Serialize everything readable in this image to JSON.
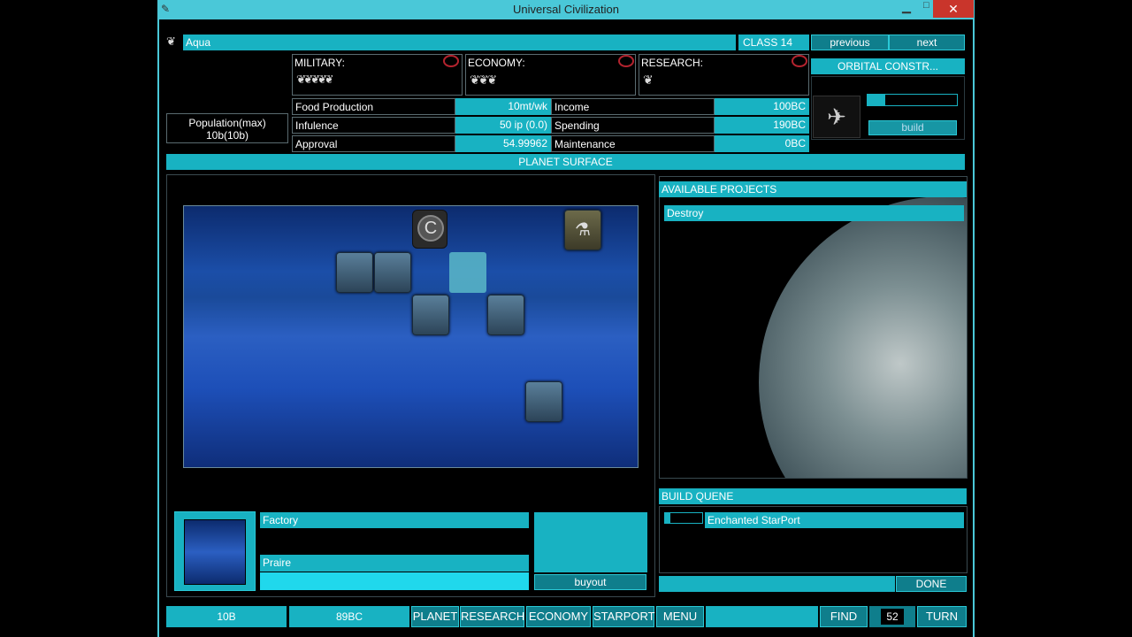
{
  "window": {
    "title": "Universal Civilization"
  },
  "header": {
    "planet_name": "Aqua",
    "class_label": "CLASS 14",
    "prev_label": "previous",
    "next_label": "next"
  },
  "ratings": {
    "military": "MILITARY:",
    "economy": "ECONOMY:",
    "research": "RESEARCH:"
  },
  "population": {
    "label": "Population(max)",
    "value": "10b(10b)"
  },
  "stats_left": [
    {
      "label": "Food Production",
      "value": "10mt/wk"
    },
    {
      "label": "Infulence",
      "value": "50 ip (0.0)"
    },
    {
      "label": "Approval",
      "value": "54.99962"
    }
  ],
  "stats_right": [
    {
      "label": "Income",
      "value": "100BC"
    },
    {
      "label": "Spending",
      "value": "190BC"
    },
    {
      "label": "Maintenance",
      "value": "0BC"
    }
  ],
  "orbital": {
    "title": "ORBITAL CONSTR...",
    "build_label": "build",
    "progress": 0.2
  },
  "surface": {
    "title": "PLANET SURFACE",
    "c_marker": "C"
  },
  "projects": {
    "title": "AVAILABLE PROJECTS",
    "items": [
      "Destroy"
    ]
  },
  "queue": {
    "title": "BUILD QUENE",
    "items": [
      {
        "name": "Enchanted StarPort",
        "progress": 0.15
      }
    ],
    "done_label": "DONE"
  },
  "selection": {
    "building": "Factory",
    "terrain": "Praire",
    "buyout_label": "buyout"
  },
  "bottom": {
    "population": "10B",
    "treasury": "89BC",
    "planet": "PLANET",
    "research": "RESEARCH",
    "economy": "ECONOMY",
    "starport": "STARPORT",
    "menu": "MENU",
    "find": "FIND",
    "turn_number": "52",
    "turn": "TURN"
  },
  "colors": {
    "accent": "#18b2c2",
    "panel_bg": "#000000",
    "map_blue": "#1d4fb8"
  }
}
